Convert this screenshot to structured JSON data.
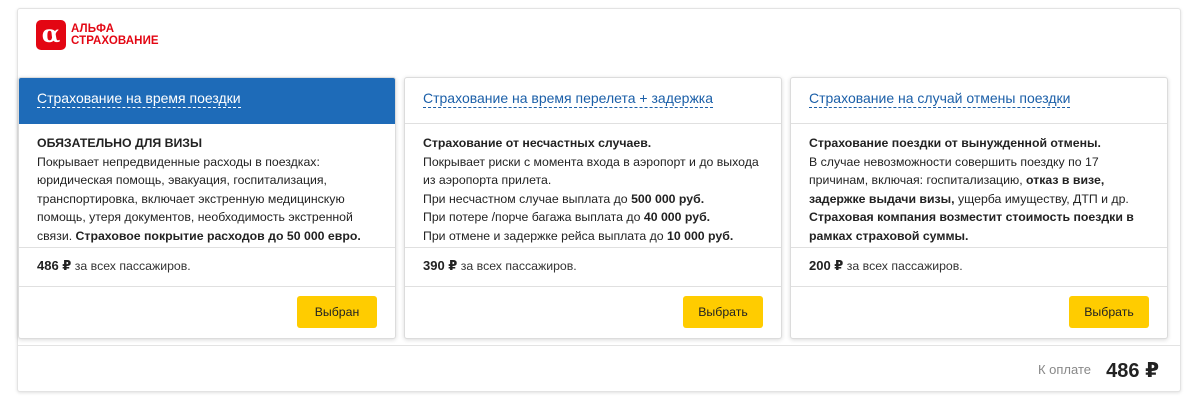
{
  "brand": {
    "logo_letter": "α",
    "name_line1": "АЛЬФА",
    "name_line2": "СТРАХОВАНИЕ",
    "color": "#e30613"
  },
  "accent_color": "#1e6bb8",
  "button_color": "#ffcc00",
  "cards": [
    {
      "title": "Страхование на время поездки",
      "selected": true,
      "lines": [
        {
          "text": "ОБЯЗАТЕЛЬНО ДЛЯ ВИЗЫ",
          "bold": true
        },
        {
          "text": "Покрывает непредвиденные расходы в поездках:"
        },
        {
          "text": "юридическая помощь, эвакуация, госпитализация,"
        },
        {
          "text": "транспортировка, включает экстренную медицинскую"
        },
        {
          "text": "помощь, утеря документов, необходимость экстренной"
        },
        {
          "text": "связи. ",
          "bold_tail": "Страховое покрытие расходов до 50 000 евро."
        }
      ],
      "price": "486 ₽",
      "price_caption": "за всех пассажиров.",
      "button_label": "Выбран"
    },
    {
      "title": "Страхование на время перелета + задержка",
      "selected": false,
      "lines": [
        {
          "text": "Страхование от несчастных случаев.",
          "bold": true
        },
        {
          "text": "Покрывает риски с момента входа в аэропорт и до выхода"
        },
        {
          "text": "из аэропорта прилета."
        },
        {
          "text": "При несчастном случае выплата до ",
          "bold_tail": "500 000 руб."
        },
        {
          "text": "При потере /порче багажа выплата до ",
          "bold_tail": "40 000 руб."
        },
        {
          "text": "При отмене и задержке рейса выплата до ",
          "bold_tail": "10 000 руб."
        }
      ],
      "price": "390 ₽",
      "price_caption": "за всех пассажиров.",
      "button_label": "Выбрать"
    },
    {
      "title": "Страхование на случай отмены поездки",
      "selected": false,
      "lines": [
        {
          "text": "Страхование поездки от вынужденной отмены.",
          "bold": true
        },
        {
          "text": "В случае невозможности совершить поездку по 17"
        },
        {
          "text": "причинам, включая: госпитализацию, ",
          "bold_tail": "отказ в визе,"
        },
        {
          "text": "задержке выдачи визы,",
          "bold": true,
          "tail": " ущерба имуществу, ДТП и др."
        },
        {
          "text": "Страховая компания возместит стоимость поездки в",
          "bold": true
        },
        {
          "text": "рамках страховой суммы.",
          "bold": true
        }
      ],
      "price": "200 ₽",
      "price_caption": "за всех пассажиров.",
      "button_label": "Выбрать"
    }
  ],
  "total": {
    "label": "К оплате",
    "value": "486 ₽"
  }
}
